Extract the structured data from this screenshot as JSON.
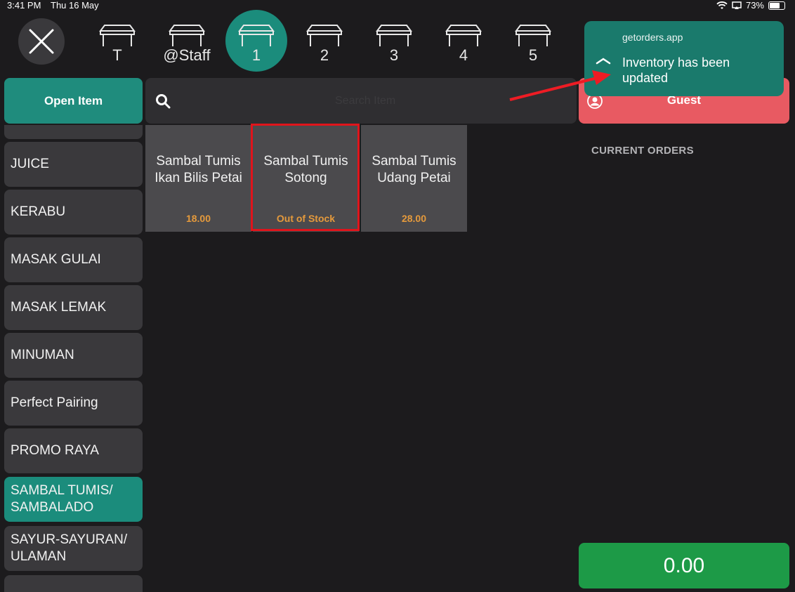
{
  "status_bar": {
    "time": "3:41 PM",
    "date": "Thu 16 May",
    "battery": "73%"
  },
  "tables": [
    {
      "label": "T",
      "active": false
    },
    {
      "label": "@Staff",
      "active": false
    },
    {
      "label": "1",
      "active": true
    },
    {
      "label": "2",
      "active": false
    },
    {
      "label": "3",
      "active": false
    },
    {
      "label": "4",
      "active": false
    },
    {
      "label": "5",
      "active": false
    }
  ],
  "toolbar": {
    "open_item_label": "Open Item",
    "search_placeholder": "Search Item",
    "guest_label": "Guest"
  },
  "categories": [
    "JUICE",
    "KERABU",
    "MASAK GULAI",
    "MASAK LEMAK",
    "MINUMAN",
    "Perfect Pairing",
    "PROMO RAYA",
    "SAMBAL TUMIS/ SAMBALADO",
    "SAYUR-SAYURAN/ ULAMAN"
  ],
  "active_category": "SAMBAL TUMIS/ SAMBALADO",
  "products": [
    {
      "name": "Sambal Tumis Ikan Bilis Petai",
      "price": "18.00"
    },
    {
      "name": "Sambal Tumis Sotong",
      "price": "Out of Stock"
    },
    {
      "name": "Sambal Tumis Udang Petai",
      "price": "28.00"
    }
  ],
  "current_orders": {
    "title": "CURRENT ORDERS"
  },
  "total": {
    "amount": "0.00"
  },
  "notification": {
    "source": "getorders.app",
    "message": "Inventory has been updated"
  },
  "colors": {
    "accent": "#1b8c7c",
    "guest": "#e85a62",
    "total": "#1d9a47",
    "price": "#e59a3c",
    "highlight": "#e0141b"
  }
}
